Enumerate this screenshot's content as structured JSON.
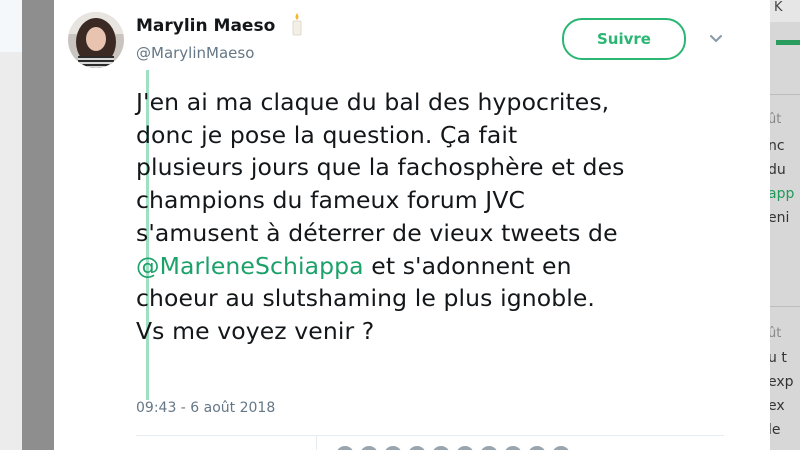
{
  "tweet": {
    "display_name": "Marylin Maeso",
    "handle": "@MarylinMaeso",
    "follow_label": "Suivre",
    "text_lines": [
      "J'en ai ma claque du bal des hypocrites,",
      "donc je pose la question. Ça fait",
      "plusieurs jours que la fachosphère et des",
      "champions du fameux forum JVC",
      "s'amusent à déterrer de vieux tweets de"
    ],
    "mention": "@MarleneSchiappa",
    "line6_rest": " et s'adonnent en",
    "text_lines_after": [
      "choeur au slutshaming le plus ignoble.",
      "Vs me voyez venir ?"
    ],
    "timestamp": "09:43 - 6 août 2018"
  },
  "background_page": {
    "header_letter": "K",
    "snippets_top": [
      "ût",
      "nc",
      "du",
      "app",
      "eni"
    ],
    "snippets_bottom": [
      "ût",
      "u t",
      "exp",
      "ex",
      "le"
    ]
  },
  "colors": {
    "accent": "#2bb673",
    "mention": "#1da16a",
    "thread_line": "#9fe0c3",
    "text": "#14171a",
    "muted": "#657786"
  },
  "icons": {
    "caret": "chevron-down-icon",
    "emoji": "candle-icon"
  }
}
